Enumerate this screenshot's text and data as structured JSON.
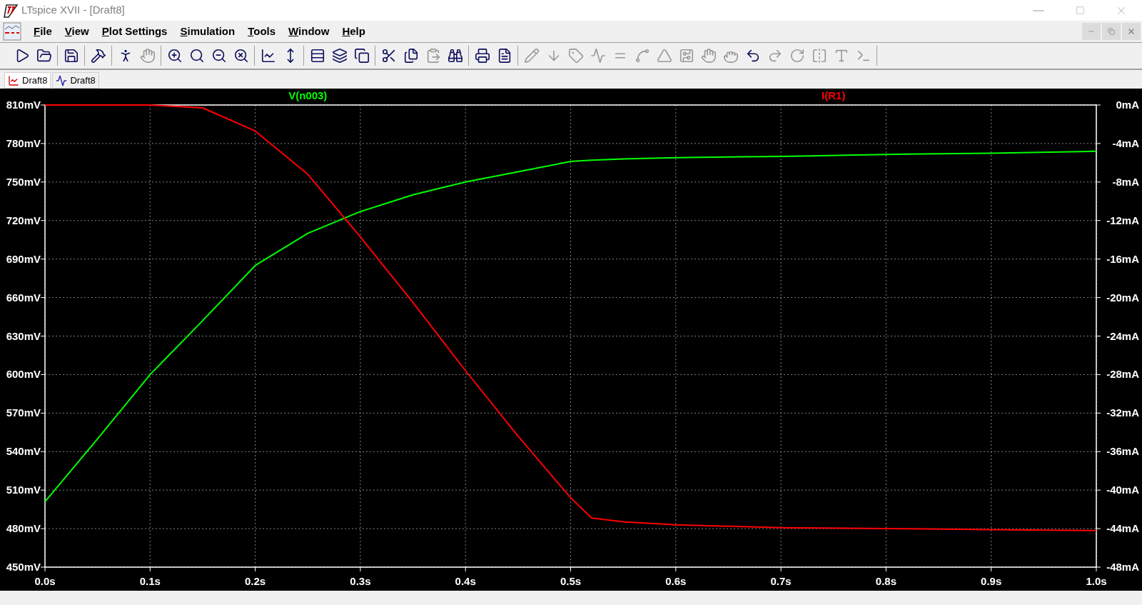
{
  "window": {
    "title": "LTspice XVII - [Draft8]"
  },
  "menu": [
    "File",
    "View",
    "Plot Settings",
    "Simulation",
    "Tools",
    "Window",
    "Help"
  ],
  "toolbar": [
    [
      {
        "disabled": false
      },
      {
        "disabled": false
      }
    ],
    [
      {
        "disabled": false
      }
    ],
    [
      {
        "disabled": false
      }
    ],
    [
      {
        "disabled": false
      },
      {
        "disabled": true
      }
    ],
    [
      {
        "disabled": false
      },
      {
        "disabled": false
      },
      {
        "disabled": false
      },
      {
        "disabled": false
      }
    ],
    [
      {
        "disabled": false
      },
      {
        "disabled": false
      }
    ],
    [
      {
        "disabled": false
      },
      {
        "disabled": false
      },
      {
        "disabled": false
      }
    ],
    [
      {
        "disabled": false
      },
      {
        "disabled": false
      },
      {
        "disabled": true
      },
      {
        "disabled": false
      }
    ],
    [
      {
        "disabled": false
      },
      {
        "disabled": false
      }
    ],
    [
      {
        "disabled": true
      },
      {
        "disabled": true
      },
      {
        "disabled": true
      },
      {
        "disabled": true
      },
      {
        "disabled": true
      },
      {
        "disabled": true
      },
      {
        "disabled": true
      },
      {
        "disabled": true
      },
      {
        "disabled": true
      },
      {
        "disabled": true
      },
      {
        "disabled": false
      },
      {
        "disabled": true
      },
      {
        "disabled": true
      },
      {
        "disabled": true
      },
      {
        "disabled": true
      },
      {
        "disabled": true
      }
    ]
  ],
  "tabs": [
    {
      "label": "Draft8",
      "kind": "waveform",
      "selected": true
    },
    {
      "label": "Draft8",
      "kind": "schematic",
      "selected": false
    }
  ],
  "plot": {
    "chart_data": {
      "type": "line",
      "x": [
        0,
        0.05,
        0.1,
        0.15,
        0.2,
        0.25,
        0.3,
        0.35,
        0.4,
        0.45,
        0.5,
        0.52,
        0.55,
        0.6,
        0.7,
        0.8,
        0.9,
        1.0
      ],
      "grid": true,
      "xlim": [
        0,
        1
      ],
      "xticks": [
        {
          "value": 0,
          "label": "0.0s"
        },
        {
          "value": 0.1,
          "label": "0.1s"
        },
        {
          "value": 0.2,
          "label": "0.2s"
        },
        {
          "value": 0.3,
          "label": "0.3s"
        },
        {
          "value": 0.4,
          "label": "0.4s"
        },
        {
          "value": 0.5,
          "label": "0.5s"
        },
        {
          "value": 0.6,
          "label": "0.6s"
        },
        {
          "value": 0.7,
          "label": "0.7s"
        },
        {
          "value": 0.8,
          "label": "0.8s"
        },
        {
          "value": 0.9,
          "label": "0.9s"
        },
        {
          "value": 1,
          "label": "1.0s"
        }
      ],
      "ylim": [
        450,
        810
      ],
      "yticks": [
        {
          "value": 810,
          "label": "810mV"
        },
        {
          "value": 780,
          "label": "780mV"
        },
        {
          "value": 750,
          "label": "750mV"
        },
        {
          "value": 720,
          "label": "720mV"
        },
        {
          "value": 690,
          "label": "690mV"
        },
        {
          "value": 660,
          "label": "660mV"
        },
        {
          "value": 630,
          "label": "630mV"
        },
        {
          "value": 600,
          "label": "600mV"
        },
        {
          "value": 570,
          "label": "570mV"
        },
        {
          "value": 540,
          "label": "540mV"
        },
        {
          "value": 510,
          "label": "510mV"
        },
        {
          "value": 480,
          "label": "480mV"
        },
        {
          "value": 450,
          "label": "450mV"
        }
      ],
      "y2lim": [
        -48,
        0
      ],
      "y2ticks": [
        {
          "value": 0,
          "label": "0mA"
        },
        {
          "value": -4,
          "label": "-4mA"
        },
        {
          "value": -8,
          "label": "-8mA"
        },
        {
          "value": -12,
          "label": "-12mA"
        },
        {
          "value": -16,
          "label": "-16mA"
        },
        {
          "value": -20,
          "label": "-20mA"
        },
        {
          "value": -24,
          "label": "-24mA"
        },
        {
          "value": -28,
          "label": "-28mA"
        },
        {
          "value": -32,
          "label": "-32mA"
        },
        {
          "value": -36,
          "label": "-36mA"
        },
        {
          "value": -40,
          "label": "-40mA"
        },
        {
          "value": -44,
          "label": "-44mA"
        },
        {
          "value": -48,
          "label": "-48mA"
        }
      ],
      "series": [
        {
          "name": "V(n003)",
          "color": "#00ff00",
          "values": [
            501,
            550,
            600,
            642,
            685,
            710,
            727,
            740,
            750,
            758,
            766,
            767,
            768,
            769,
            770,
            771.5,
            772.5,
            774
          ]
        },
        {
          "name": "I(R1)",
          "color": "#ff0000",
          "axis": "y2",
          "values": [
            0,
            0,
            0,
            -0.3,
            -2.7,
            -7.2,
            -13.7,
            -20.5,
            -27.6,
            -34.4,
            -40.8,
            -42.9,
            -43.3,
            -43.6,
            -43.9,
            -44,
            -44.1,
            -44.2
          ]
        }
      ]
    }
  }
}
